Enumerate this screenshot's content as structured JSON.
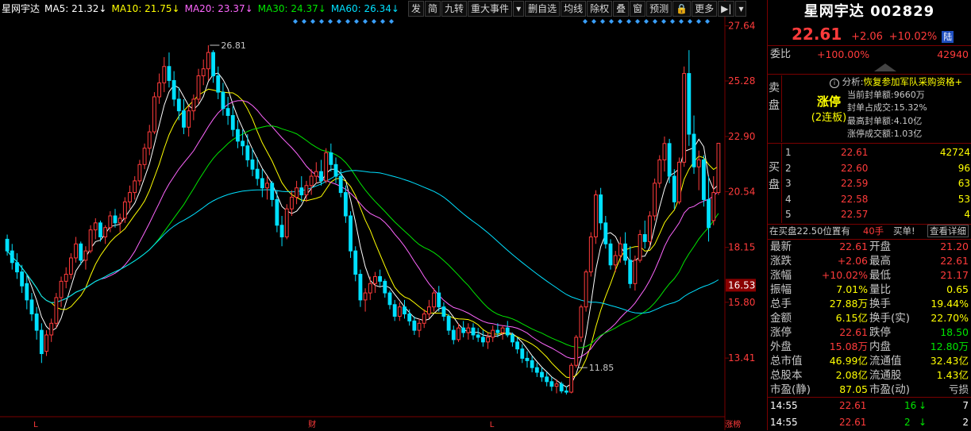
{
  "ma_legend": [
    {
      "text": "星网宇达",
      "color": "#ffffff"
    },
    {
      "text": "MA5: 21.32↓",
      "color": "#ffffff"
    },
    {
      "text": "MA10: 21.75↓",
      "color": "#ffff00"
    },
    {
      "text": "MA20: 23.37↓",
      "color": "#ff66ff"
    },
    {
      "text": "MA30: 24.37↓",
      "color": "#00e600"
    },
    {
      "text": "MA60: 26.34↓",
      "color": "#00e0ff"
    }
  ],
  "toolbar": [
    "发",
    "简",
    "九转",
    "重大事件",
    "▾",
    "删自选",
    "均线",
    "除权",
    "叠",
    "窗",
    "预测",
    "🔒",
    "更多",
    "▶|",
    "▾"
  ],
  "chart_data": {
    "type": "candlestick",
    "y_axis_ticks": [
      "27.64",
      "25.28",
      "22.90",
      "20.54",
      "18.15",
      "15.80",
      "13.41"
    ],
    "current_price_tag": "16.53",
    "annotations": [
      {
        "label": "26.81",
        "index": 41,
        "kind": "high"
      },
      {
        "label": "11.85",
        "index": 116,
        "kind": "low"
      }
    ],
    "bottom_markers": [
      {
        "label": "L",
        "index": 6
      },
      {
        "label": "财",
        "index": 62
      },
      {
        "label": "L",
        "index": 99
      },
      {
        "label": "涨榜",
        "index": 147
      }
    ],
    "colors": {
      "up": "#ff3b3b",
      "down": "#00e0ff",
      "ma5": "#ffffff",
      "ma10": "#ffff00",
      "ma20": "#ff66ff",
      "ma30": "#00e600",
      "ma60": "#00e0ff"
    },
    "ylim": [
      11.0,
      28.0
    ],
    "candles": [
      [
        18.5,
        18.7,
        17.8,
        18.0
      ],
      [
        18.0,
        18.3,
        17.2,
        17.5
      ],
      [
        17.5,
        17.9,
        16.8,
        17.1
      ],
      [
        17.1,
        17.4,
        16.2,
        16.5
      ],
      [
        16.6,
        17.0,
        15.5,
        15.9
      ],
      [
        15.9,
        16.2,
        15.0,
        15.3
      ],
      [
        15.3,
        15.6,
        14.2,
        14.6
      ],
      [
        14.6,
        14.9,
        13.2,
        13.6
      ],
      [
        13.7,
        14.6,
        13.5,
        14.4
      ],
      [
        14.4,
        15.1,
        14.1,
        14.9
      ],
      [
        14.9,
        16.2,
        14.7,
        16.0
      ],
      [
        16.0,
        16.9,
        15.6,
        16.7
      ],
      [
        16.7,
        17.3,
        16.4,
        17.0
      ],
      [
        17.0,
        17.9,
        16.8,
        17.7
      ],
      [
        17.7,
        18.6,
        17.5,
        18.3
      ],
      [
        18.3,
        18.4,
        17.4,
        17.6
      ],
      [
        17.6,
        18.2,
        17.2,
        18.0
      ],
      [
        18.0,
        19.1,
        17.9,
        18.9
      ],
      [
        18.9,
        19.4,
        18.5,
        19.2
      ],
      [
        19.2,
        19.3,
        18.4,
        18.6
      ],
      [
        18.6,
        19.1,
        18.3,
        19.0
      ],
      [
        19.0,
        19.7,
        18.8,
        19.5
      ],
      [
        19.5,
        19.8,
        19.0,
        19.2
      ],
      [
        19.2,
        19.6,
        18.8,
        19.4
      ],
      [
        19.4,
        20.3,
        19.2,
        20.1
      ],
      [
        20.1,
        20.8,
        19.8,
        20.5
      ],
      [
        20.5,
        21.2,
        20.2,
        21.0
      ],
      [
        21.0,
        21.9,
        20.8,
        21.7
      ],
      [
        21.7,
        22.6,
        21.5,
        22.4
      ],
      [
        22.4,
        23.4,
        22.1,
        23.1
      ],
      [
        23.1,
        24.8,
        23.0,
        24.6
      ],
      [
        24.6,
        25.6,
        24.3,
        25.2
      ],
      [
        25.2,
        26.3,
        24.8,
        25.9
      ],
      [
        25.9,
        26.5,
        25.0,
        25.3
      ],
      [
        25.3,
        25.7,
        24.2,
        24.5
      ],
      [
        24.5,
        25.0,
        23.6,
        24.0
      ],
      [
        24.0,
        24.5,
        23.0,
        23.3
      ],
      [
        23.3,
        24.2,
        22.9,
        24.0
      ],
      [
        24.0,
        24.7,
        23.6,
        24.5
      ],
      [
        24.5,
        25.8,
        24.3,
        25.5
      ],
      [
        25.5,
        26.2,
        25.1,
        25.8
      ],
      [
        25.8,
        26.81,
        25.3,
        26.5
      ],
      [
        26.5,
        26.6,
        25.2,
        25.5
      ],
      [
        25.5,
        25.9,
        24.5,
        24.8
      ],
      [
        24.8,
        25.2,
        23.8,
        24.1
      ],
      [
        24.1,
        24.6,
        23.4,
        23.8
      ],
      [
        23.8,
        24.2,
        22.9,
        23.2
      ],
      [
        23.2,
        23.6,
        22.4,
        22.7
      ],
      [
        22.7,
        23.2,
        22.1,
        22.5
      ],
      [
        22.5,
        23.0,
        21.6,
        21.9
      ],
      [
        21.9,
        22.4,
        21.2,
        21.5
      ],
      [
        21.5,
        22.0,
        20.8,
        21.1
      ],
      [
        21.1,
        21.5,
        20.3,
        20.7
      ],
      [
        20.7,
        21.2,
        20.2,
        20.9
      ],
      [
        20.9,
        21.0,
        19.9,
        20.2
      ],
      [
        20.2,
        20.6,
        18.8,
        19.1
      ],
      [
        19.1,
        19.5,
        18.2,
        18.6
      ],
      [
        18.6,
        20.0,
        18.5,
        19.8
      ],
      [
        19.8,
        20.6,
        19.5,
        20.3
      ],
      [
        20.3,
        21.0,
        20.0,
        20.7
      ],
      [
        20.7,
        21.2,
        20.1,
        20.4
      ],
      [
        20.4,
        21.0,
        20.1,
        20.8
      ],
      [
        20.8,
        21.5,
        20.4,
        21.2
      ],
      [
        21.2,
        21.8,
        20.9,
        21.4
      ],
      [
        21.4,
        21.9,
        20.8,
        21.0
      ],
      [
        21.0,
        22.4,
        20.9,
        22.2
      ],
      [
        22.2,
        22.6,
        21.4,
        21.7
      ],
      [
        21.7,
        22.0,
        20.9,
        21.2
      ],
      [
        21.2,
        21.5,
        20.3,
        20.5
      ],
      [
        20.5,
        20.8,
        19.2,
        19.5
      ],
      [
        19.5,
        19.7,
        17.7,
        18.0
      ],
      [
        18.0,
        18.2,
        16.7,
        17.0
      ],
      [
        17.0,
        17.2,
        15.6,
        15.9
      ],
      [
        15.9,
        16.4,
        15.4,
        16.2
      ],
      [
        16.2,
        16.9,
        15.9,
        16.6
      ],
      [
        16.6,
        17.1,
        16.2,
        16.9
      ],
      [
        16.9,
        17.2,
        16.5,
        16.7
      ],
      [
        16.7,
        16.8,
        16.0,
        16.2
      ],
      [
        16.2,
        16.3,
        15.5,
        15.7
      ],
      [
        15.7,
        15.9,
        15.0,
        15.2
      ],
      [
        15.2,
        15.8,
        15.0,
        15.6
      ],
      [
        15.6,
        15.9,
        15.1,
        15.3
      ],
      [
        15.3,
        15.5,
        14.8,
        15.0
      ],
      [
        15.0,
        15.2,
        14.4,
        14.6
      ],
      [
        14.6,
        15.1,
        14.3,
        14.9
      ],
      [
        14.9,
        15.5,
        14.7,
        15.3
      ],
      [
        15.3,
        15.9,
        15.1,
        15.6
      ],
      [
        15.6,
        16.4,
        15.4,
        16.2
      ],
      [
        16.2,
        16.5,
        15.4,
        15.6
      ],
      [
        15.6,
        15.8,
        15.0,
        15.2
      ],
      [
        15.2,
        15.3,
        14.4,
        14.6
      ],
      [
        14.6,
        14.8,
        14.0,
        14.2
      ],
      [
        14.2,
        14.9,
        14.1,
        14.7
      ],
      [
        14.7,
        15.0,
        14.3,
        14.5
      ],
      [
        14.5,
        14.9,
        14.2,
        14.7
      ],
      [
        14.7,
        14.9,
        14.2,
        14.4
      ],
      [
        14.4,
        14.7,
        14.1,
        14.3
      ],
      [
        14.3,
        14.6,
        13.9,
        14.1
      ],
      [
        14.1,
        14.5,
        13.8,
        14.3
      ],
      [
        14.3,
        14.8,
        14.1,
        14.6
      ],
      [
        14.6,
        14.9,
        14.3,
        14.5
      ],
      [
        14.5,
        14.8,
        14.2,
        14.7
      ],
      [
        14.7,
        15.0,
        14.3,
        14.4
      ],
      [
        14.4,
        14.5,
        13.9,
        14.1
      ],
      [
        14.1,
        14.3,
        13.6,
        13.8
      ],
      [
        13.8,
        14.0,
        13.2,
        13.4
      ],
      [
        13.4,
        13.7,
        13.0,
        13.3
      ],
      [
        13.3,
        13.5,
        12.8,
        13.0
      ],
      [
        13.0,
        13.2,
        12.6,
        12.8
      ],
      [
        12.8,
        13.0,
        12.4,
        12.6
      ],
      [
        12.6,
        12.8,
        12.2,
        12.4
      ],
      [
        12.4,
        12.6,
        12.0,
        12.2
      ],
      [
        12.2,
        12.5,
        11.9,
        12.3
      ],
      [
        12.3,
        12.4,
        11.9,
        12.0
      ],
      [
        12.0,
        12.2,
        11.85,
        11.95
      ],
      [
        11.95,
        13.2,
        11.9,
        13.1
      ],
      [
        13.1,
        14.4,
        13.0,
        14.3
      ],
      [
        14.3,
        15.7,
        14.1,
        15.6
      ],
      [
        15.6,
        17.2,
        15.4,
        17.1
      ],
      [
        17.1,
        18.8,
        16.9,
        18.6
      ],
      [
        18.6,
        20.6,
        18.3,
        20.4
      ],
      [
        20.4,
        20.7,
        18.9,
        19.2
      ],
      [
        19.2,
        19.5,
        18.1,
        18.3
      ],
      [
        18.3,
        18.5,
        17.2,
        17.4
      ],
      [
        17.4,
        18.0,
        17.1,
        17.8
      ],
      [
        17.8,
        18.6,
        17.5,
        18.3
      ],
      [
        18.3,
        18.8,
        17.4,
        17.6
      ],
      [
        17.6,
        18.2,
        16.4,
        16.6
      ],
      [
        16.6,
        17.8,
        16.3,
        17.6
      ],
      [
        17.6,
        18.9,
        17.5,
        18.7
      ],
      [
        18.7,
        19.3,
        18.1,
        18.4
      ],
      [
        18.4,
        19.7,
        18.2,
        19.5
      ],
      [
        19.5,
        21.1,
        19.3,
        20.9
      ],
      [
        20.9,
        22.1,
        20.7,
        21.9
      ],
      [
        21.9,
        22.9,
        21.4,
        22.6
      ],
      [
        22.6,
        22.8,
        20.9,
        21.2
      ],
      [
        21.2,
        21.5,
        19.8,
        20.1
      ],
      [
        20.1,
        22.0,
        20.0,
        21.8
      ],
      [
        21.8,
        25.9,
        21.6,
        25.6
      ],
      [
        25.6,
        26.6,
        22.5,
        23.0
      ],
      [
        23.0,
        23.8,
        21.3,
        21.6
      ],
      [
        21.6,
        22.3,
        20.6,
        21.9
      ],
      [
        21.9,
        22.1,
        19.9,
        20.2
      ],
      [
        20.2,
        21.2,
        18.4,
        19.0
      ],
      [
        19.3,
        21.2,
        19.1,
        20.5
      ],
      [
        20.5,
        22.61,
        20.4,
        22.61
      ]
    ]
  },
  "side": {
    "name": "星网宇达",
    "code": "002829",
    "price": "22.61",
    "change": "+2.06",
    "pct": "+10.02%",
    "lu": "陆",
    "weibi_label": "委比",
    "weibi_pct": "+100.00%",
    "weibi_diff": "42940",
    "sell_label": "卖盘",
    "limit_title": "涨停",
    "limit_sub": "(2连板)",
    "analysis_prefix": "分析:",
    "analysis_text": "恢复参加军队采购资格+",
    "analysis_lines": [
      "当前封单额:9660万",
      "封单占成交:15.32%",
      "最高封单额:4.10亿",
      "涨停成交额:1.03亿"
    ],
    "buy_label": "买盘",
    "buy_orders": [
      {
        "lvl": "1",
        "price": "22.61",
        "vol": "42724"
      },
      {
        "lvl": "2",
        "price": "22.60",
        "vol": "96"
      },
      {
        "lvl": "3",
        "price": "22.59",
        "vol": "63"
      },
      {
        "lvl": "4",
        "price": "22.58",
        "vol": "53"
      },
      {
        "lvl": "5",
        "price": "22.57",
        "vol": "4"
      }
    ],
    "buy_notice_a": "在买盘22.50位置有",
    "buy_notice_b": "40手",
    "buy_notice_c": "买单!",
    "buy_notice_d": "查看详细",
    "quote_rows": [
      {
        "l1": "最新",
        "v1": "22.61",
        "c1": "red",
        "l2": "开盘",
        "v2": "21.20",
        "c2": "red"
      },
      {
        "l1": "涨跌",
        "v1": "+2.06",
        "c1": "red",
        "l2": "最高",
        "v2": "22.61",
        "c2": "red"
      },
      {
        "l1": "涨幅",
        "v1": "+10.02%",
        "c1": "red",
        "l2": "最低",
        "v2": "21.17",
        "c2": "red"
      },
      {
        "l1": "振幅",
        "v1": "7.01%",
        "c1": "yellow",
        "l2": "量比",
        "v2": "0.65",
        "c2": "yellow"
      },
      {
        "l1": "总手",
        "v1": "27.88万",
        "c1": "yellow",
        "l2": "换手",
        "v2": "19.44%",
        "c2": "yellow"
      },
      {
        "l1": "金额",
        "v1": "6.15亿",
        "c1": "yellow",
        "l2": "换手(实)",
        "v2": "22.70%",
        "c2": "yellow"
      },
      {
        "l1": "涨停",
        "v1": "22.61",
        "c1": "red",
        "l2": "跌停",
        "v2": "18.50",
        "c2": "green"
      },
      {
        "l1": "外盘",
        "v1": "15.08万",
        "c1": "red",
        "l2": "内盘",
        "v2": "12.80万",
        "c2": "green"
      },
      {
        "l1": "总市值",
        "v1": "46.99亿",
        "c1": "yellow",
        "l2": "流通值",
        "v2": "32.43亿",
        "c2": "yellow"
      },
      {
        "l1": "总股本",
        "v1": "2.08亿",
        "c1": "yellow",
        "l2": "流通股",
        "v2": "1.43亿",
        "c2": "yellow"
      },
      {
        "l1": "市盈(静)",
        "v1": "87.05",
        "c1": "yellow",
        "l2": "市盈(动)",
        "v2": "亏损",
        "c2": "grey"
      }
    ],
    "ticks": [
      {
        "time": "14:55",
        "price": "22.61",
        "vol": "16",
        "arrow": "↓",
        "n": "7"
      },
      {
        "time": "14:55",
        "price": "22.61",
        "vol": "2",
        "arrow": "↓",
        "n": "2"
      }
    ]
  }
}
